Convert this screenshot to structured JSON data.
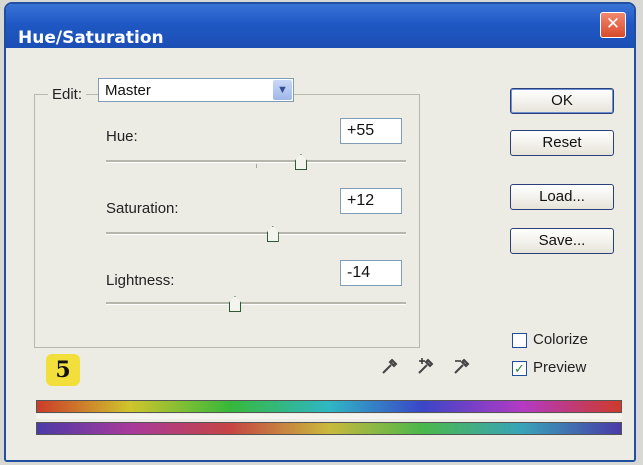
{
  "window": {
    "title": "Hue/Saturation",
    "close_glyph": "✕"
  },
  "edit": {
    "label": "Edit:",
    "value": "Master",
    "arrow_glyph": "▼"
  },
  "sliders": {
    "hue": {
      "label": "Hue:",
      "value": "+55",
      "level": 0.65
    },
    "saturation": {
      "label": "Saturation:",
      "value": "+12",
      "level": 0.556
    },
    "lightness": {
      "label": "Lightness:",
      "value": "-14",
      "level": 0.43
    }
  },
  "buttons": {
    "ok": "OK",
    "reset": "Reset",
    "load": "Load...",
    "save": "Save..."
  },
  "options": {
    "colorize": {
      "label": "Colorize",
      "checked": false,
      "mark": ""
    },
    "preview": {
      "label": "Preview",
      "checked": true,
      "mark": "✓"
    }
  },
  "step_badge": "5",
  "icons": {
    "eyedropper": "eyedropper-icon",
    "eyedropper_plus": "eyedropper-plus-icon",
    "eyedropper_minus": "eyedropper-minus-icon"
  },
  "colors": {
    "title_bar": "#1f58c4",
    "window_bg": "#ecebe4",
    "badge": "#f3df3c",
    "close_button": "#d94a2c"
  }
}
